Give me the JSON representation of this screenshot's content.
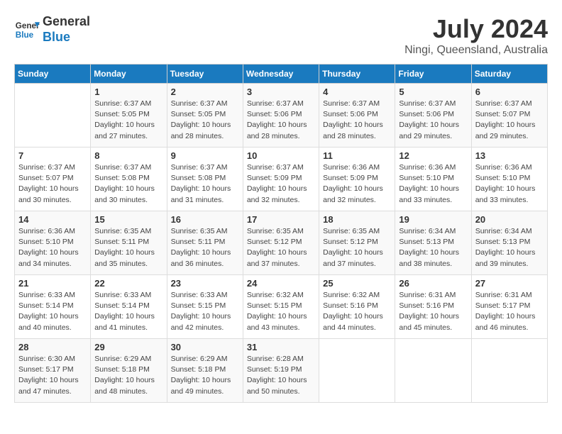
{
  "header": {
    "logo_line1": "General",
    "logo_line2": "Blue",
    "month_year": "July 2024",
    "location": "Ningi, Queensland, Australia"
  },
  "weekdays": [
    "Sunday",
    "Monday",
    "Tuesday",
    "Wednesday",
    "Thursday",
    "Friday",
    "Saturday"
  ],
  "weeks": [
    [
      {
        "day": "",
        "info": ""
      },
      {
        "day": "1",
        "info": "Sunrise: 6:37 AM\nSunset: 5:05 PM\nDaylight: 10 hours\nand 27 minutes."
      },
      {
        "day": "2",
        "info": "Sunrise: 6:37 AM\nSunset: 5:05 PM\nDaylight: 10 hours\nand 28 minutes."
      },
      {
        "day": "3",
        "info": "Sunrise: 6:37 AM\nSunset: 5:06 PM\nDaylight: 10 hours\nand 28 minutes."
      },
      {
        "day": "4",
        "info": "Sunrise: 6:37 AM\nSunset: 5:06 PM\nDaylight: 10 hours\nand 28 minutes."
      },
      {
        "day": "5",
        "info": "Sunrise: 6:37 AM\nSunset: 5:06 PM\nDaylight: 10 hours\nand 29 minutes."
      },
      {
        "day": "6",
        "info": "Sunrise: 6:37 AM\nSunset: 5:07 PM\nDaylight: 10 hours\nand 29 minutes."
      }
    ],
    [
      {
        "day": "7",
        "info": "Sunrise: 6:37 AM\nSunset: 5:07 PM\nDaylight: 10 hours\nand 30 minutes."
      },
      {
        "day": "8",
        "info": "Sunrise: 6:37 AM\nSunset: 5:08 PM\nDaylight: 10 hours\nand 30 minutes."
      },
      {
        "day": "9",
        "info": "Sunrise: 6:37 AM\nSunset: 5:08 PM\nDaylight: 10 hours\nand 31 minutes."
      },
      {
        "day": "10",
        "info": "Sunrise: 6:37 AM\nSunset: 5:09 PM\nDaylight: 10 hours\nand 32 minutes."
      },
      {
        "day": "11",
        "info": "Sunrise: 6:36 AM\nSunset: 5:09 PM\nDaylight: 10 hours\nand 32 minutes."
      },
      {
        "day": "12",
        "info": "Sunrise: 6:36 AM\nSunset: 5:10 PM\nDaylight: 10 hours\nand 33 minutes."
      },
      {
        "day": "13",
        "info": "Sunrise: 6:36 AM\nSunset: 5:10 PM\nDaylight: 10 hours\nand 33 minutes."
      }
    ],
    [
      {
        "day": "14",
        "info": "Sunrise: 6:36 AM\nSunset: 5:10 PM\nDaylight: 10 hours\nand 34 minutes."
      },
      {
        "day": "15",
        "info": "Sunrise: 6:35 AM\nSunset: 5:11 PM\nDaylight: 10 hours\nand 35 minutes."
      },
      {
        "day": "16",
        "info": "Sunrise: 6:35 AM\nSunset: 5:11 PM\nDaylight: 10 hours\nand 36 minutes."
      },
      {
        "day": "17",
        "info": "Sunrise: 6:35 AM\nSunset: 5:12 PM\nDaylight: 10 hours\nand 37 minutes."
      },
      {
        "day": "18",
        "info": "Sunrise: 6:35 AM\nSunset: 5:12 PM\nDaylight: 10 hours\nand 37 minutes."
      },
      {
        "day": "19",
        "info": "Sunrise: 6:34 AM\nSunset: 5:13 PM\nDaylight: 10 hours\nand 38 minutes."
      },
      {
        "day": "20",
        "info": "Sunrise: 6:34 AM\nSunset: 5:13 PM\nDaylight: 10 hours\nand 39 minutes."
      }
    ],
    [
      {
        "day": "21",
        "info": "Sunrise: 6:33 AM\nSunset: 5:14 PM\nDaylight: 10 hours\nand 40 minutes."
      },
      {
        "day": "22",
        "info": "Sunrise: 6:33 AM\nSunset: 5:14 PM\nDaylight: 10 hours\nand 41 minutes."
      },
      {
        "day": "23",
        "info": "Sunrise: 6:33 AM\nSunset: 5:15 PM\nDaylight: 10 hours\nand 42 minutes."
      },
      {
        "day": "24",
        "info": "Sunrise: 6:32 AM\nSunset: 5:15 PM\nDaylight: 10 hours\nand 43 minutes."
      },
      {
        "day": "25",
        "info": "Sunrise: 6:32 AM\nSunset: 5:16 PM\nDaylight: 10 hours\nand 44 minutes."
      },
      {
        "day": "26",
        "info": "Sunrise: 6:31 AM\nSunset: 5:16 PM\nDaylight: 10 hours\nand 45 minutes."
      },
      {
        "day": "27",
        "info": "Sunrise: 6:31 AM\nSunset: 5:17 PM\nDaylight: 10 hours\nand 46 minutes."
      }
    ],
    [
      {
        "day": "28",
        "info": "Sunrise: 6:30 AM\nSunset: 5:17 PM\nDaylight: 10 hours\nand 47 minutes."
      },
      {
        "day": "29",
        "info": "Sunrise: 6:29 AM\nSunset: 5:18 PM\nDaylight: 10 hours\nand 48 minutes."
      },
      {
        "day": "30",
        "info": "Sunrise: 6:29 AM\nSunset: 5:18 PM\nDaylight: 10 hours\nand 49 minutes."
      },
      {
        "day": "31",
        "info": "Sunrise: 6:28 AM\nSunset: 5:19 PM\nDaylight: 10 hours\nand 50 minutes."
      },
      {
        "day": "",
        "info": ""
      },
      {
        "day": "",
        "info": ""
      },
      {
        "day": "",
        "info": ""
      }
    ]
  ]
}
